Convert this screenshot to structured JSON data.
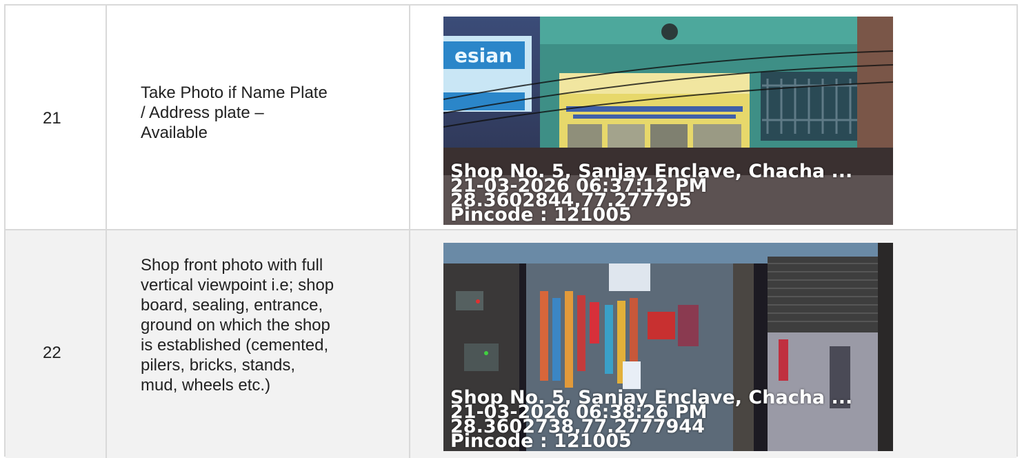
{
  "rows": [
    {
      "number": "21",
      "description": "Take Photo if Name Plate\n/ Address plate –\nAvailable",
      "photo": {
        "address": "Shop No. 5, Sanjay Enclave, Chacha ...",
        "datetime": "21-03-2026 06:37:12 PM",
        "coordinates": "28.3602844,77.277795",
        "pincode": "Pincode : 121005"
      }
    },
    {
      "number": "22",
      "description": "Shop front photo with full\nvertical viewpoint i.e; shop\nboard, sealing, entrance,\nground on which the shop\nis established (cemented,\npilers, bricks, stands,\nmud, wheels etc.)",
      "photo": {
        "address": "Shop No. 5, Sanjay Enclave, Chacha ...",
        "datetime": "21-03-2026 06:38:26 PM",
        "coordinates": "28.3602738,77.2777944",
        "pincode": "Pincode : 121005"
      }
    }
  ]
}
